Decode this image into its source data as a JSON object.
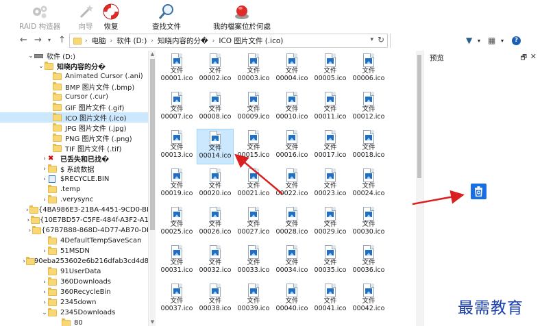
{
  "toolbar": {
    "raid_label": "RAID 构造器",
    "wizard_label": "向导",
    "restore_label": "恢复",
    "find_label": "查找文件",
    "myfiles_label": "我的檔案位於何處"
  },
  "address": {
    "crumbs": [
      "电脑",
      "软件 (D:)",
      "知晓内容的分�",
      "ICO 图片文件 (.ico)"
    ]
  },
  "tree": {
    "items": [
      "软件 (D:)",
      "知晓内容的分�",
      "Animated Cursor (.ani)",
      "BMP 图片文件 (.bmp)",
      "Cursor (.cur)",
      "GIF 图片文件 (.gif)",
      "ICO 图片文件 (.ico)",
      "JPG 图片文件 (.jpg)",
      "PNG 图片文件 (.png)",
      "TIF 图片文件 (.tif)",
      "已丢失和已找�",
      "$ 系统数据",
      "$RECYCLE.BIN",
      ".temp",
      ".verysync",
      "{4BA986E3-21BA-4451-9CD0-BI",
      "{10E7BD57-C5FE-484f-A3F2-A1",
      "{67B7B88-868D-4D77-AB70-DI",
      "4DefaultTempSaveScan",
      "51MSDN",
      "90eba253602e6b216dfab3cd4d8",
      "91UserData",
      "360Downloads",
      "360RecycleBin",
      "2345down",
      "2345Downloads",
      "80"
    ]
  },
  "files": {
    "label": "文件",
    "names": [
      "00001.ico",
      "00002.ico",
      "00003.ico",
      "00004.ico",
      "00005.ico",
      "00006.ico",
      "00007.ico",
      "00008.ico",
      "00009.ico",
      "00010.ico",
      "00011.ico",
      "00012.ico",
      "00013.ico",
      "00014.ico",
      "00015.ico",
      "00016.ico",
      "00017.ico",
      "00018.ico",
      "00019.ico",
      "00020.ico",
      "00021.ico",
      "00022.ico",
      "00023.ico",
      "00024.ico",
      "00025.ico",
      "00026.ico",
      "00027.ico",
      "00028.ico",
      "00029.ico",
      "00030.ico",
      "00031.ico",
      "00032.ico",
      "00033.ico",
      "00034.ico",
      "00035.ico",
      "00036.ico",
      "00037.ico",
      "00038.ico",
      "00039.ico",
      "00040.ico",
      "00041.ico",
      "00042.ico"
    ],
    "selected": "00014.ico"
  },
  "preview": {
    "title": "预览",
    "pin": "🗗",
    "close": "✕"
  },
  "watermark": "最需教育",
  "colors": {
    "accent": "#1a6ee0",
    "selection": "#cce8ff",
    "arrow": "#d92020",
    "watermark": "#1a3fa8"
  }
}
